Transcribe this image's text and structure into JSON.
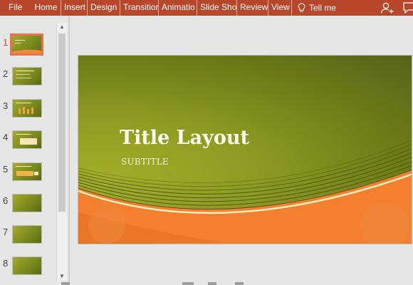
{
  "ribbon": {
    "tabs": [
      "File",
      "Home",
      "Insert",
      "Design",
      "Transitior",
      "Animatio",
      "Slide Sho",
      "Review",
      "View"
    ],
    "tell_me": "Tell me",
    "colors": {
      "ribbon_bg": "#b7472a",
      "text": "#ffffff"
    }
  },
  "thumbnails": {
    "numbers": [
      "1",
      "2",
      "3",
      "4",
      "5",
      "6",
      "7",
      "8"
    ],
    "selected": "1"
  },
  "slide": {
    "title": "Title Layout",
    "subtitle": "SUBTITLE",
    "colors": {
      "background": "#8f9a22",
      "accent": "#f47f2e",
      "title_text": "#fbfbf0"
    }
  },
  "icons": {
    "tell_me": "lightbulb-icon",
    "share": "add-person-icon",
    "comments": "comment-icon",
    "scroll_up": "chevron-up-icon",
    "scroll_down": "chevron-down-icon"
  }
}
